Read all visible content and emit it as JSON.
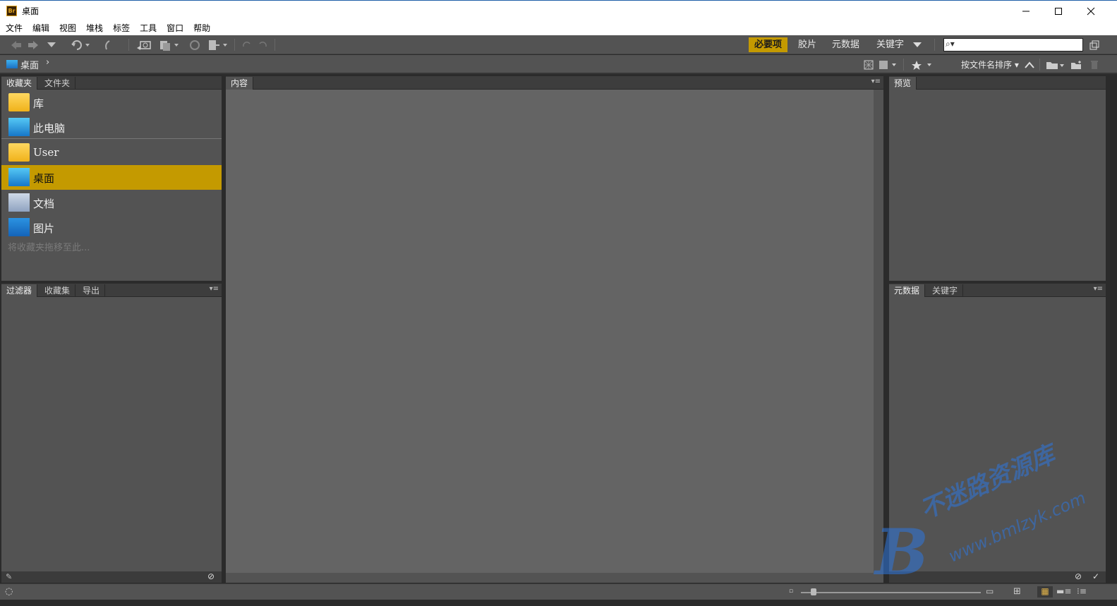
{
  "window": {
    "app_icon": "Br",
    "title": "桌面",
    "controls": {
      "minimize": "—",
      "maximize": "☐",
      "close": "✕"
    }
  },
  "menu": [
    "文件",
    "编辑",
    "视图",
    "堆栈",
    "标签",
    "工具",
    "窗口",
    "帮助"
  ],
  "toolbar": {
    "workspaces": [
      "必要项",
      "胶片",
      "元数据",
      "关键字"
    ],
    "active_workspace": "必要项",
    "search": {
      "value": "",
      "placeholder": ""
    }
  },
  "pathbar": {
    "current": "桌面",
    "sort_label": "按文件名排序"
  },
  "favorites_panel": {
    "tabs": [
      "收藏夹",
      "文件夹"
    ],
    "active_tab": "收藏夹",
    "items": [
      {
        "label": "库",
        "icon": "folder-icon"
      },
      {
        "label": "此电脑",
        "icon": "monitor-icon"
      },
      {
        "label": "User",
        "icon": "folder-icon"
      },
      {
        "label": "桌面",
        "icon": "desktop-icon",
        "selected": true
      },
      {
        "label": "文档",
        "icon": "document-icon"
      },
      {
        "label": "图片",
        "icon": "pictures-icon"
      }
    ],
    "drop_hint": "将收藏夹拖移至此..."
  },
  "filter_panel": {
    "tabs": [
      "过滤器",
      "收藏集",
      "导出"
    ],
    "active_tab": "过滤器"
  },
  "content_panel": {
    "tab": "内容"
  },
  "preview_panel": {
    "tab": "预览"
  },
  "metadata_panel": {
    "tabs": [
      "元数据",
      "关键字"
    ],
    "active_tab": "元数据"
  },
  "watermark": {
    "logo": "B",
    "title": "不迷路资源库",
    "url": "www.bmlzyk.com"
  },
  "colors": {
    "accent": "#c49a00",
    "panel": "#535353",
    "content": "#646464"
  }
}
